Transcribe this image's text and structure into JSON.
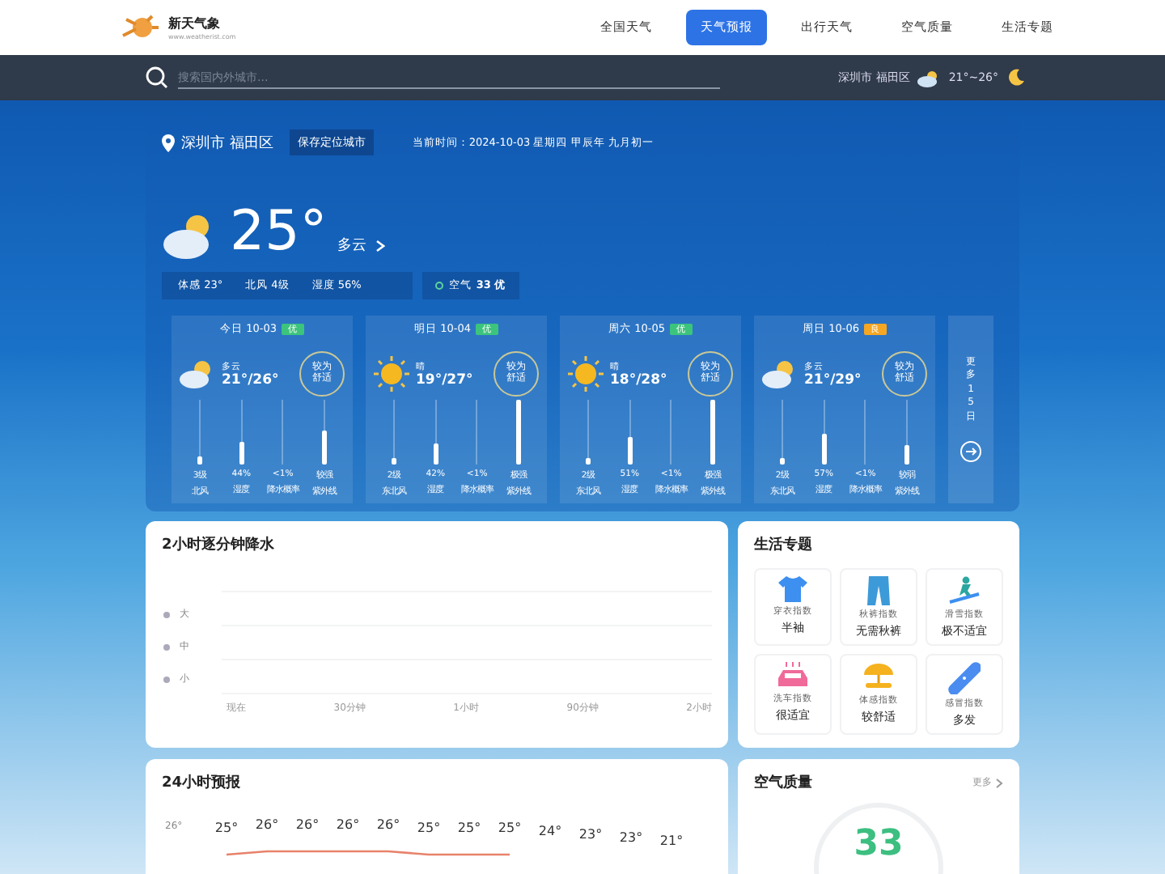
{
  "header": {
    "logo_title": "新天气象",
    "logo_url": "www.weatherist.com",
    "nav": [
      {
        "label": "全国天气",
        "selected": false
      },
      {
        "label": "天气预报",
        "selected": true
      },
      {
        "label": "出行天气",
        "selected": false
      },
      {
        "label": "空气质量",
        "selected": false
      },
      {
        "label": "生活专题",
        "selected": false
      }
    ]
  },
  "search_bar": {
    "placeholder": "搜索国内外城市...",
    "location": "深圳市 福田区",
    "temp_range": "21°~26°"
  },
  "current": {
    "location": "深圳市 福田区",
    "save_button": "保存定位城市",
    "time": "当前时间：2024-10-03 星期四 甲辰年 九月初一",
    "temperature": "25°",
    "condition": "多云",
    "details": [
      "体感 23°",
      "北风 4级",
      "湿度 56%"
    ],
    "air_label": "空气",
    "air_value": "33 优"
  },
  "days": [
    {
      "title": "今日 10-03",
      "aqi": "优",
      "color": "#3cc47c",
      "kind": "partly-cloudy",
      "condition": "多云",
      "temps": "21°/26°",
      "comfort": "较为舒适",
      "stats": [
        {
          "value": "3级",
          "label": "北风",
          "level": 0.12
        },
        {
          "value": "44%",
          "label": "湿度",
          "level": 0.35
        },
        {
          "value": "<1%",
          "label": "降水概率",
          "level": 0
        },
        {
          "value": "较强",
          "label": "紫外线",
          "level": 0.52
        }
      ]
    },
    {
      "title": "明日 10-04",
      "aqi": "优",
      "color": "#3cc47c",
      "kind": "sunny",
      "condition": "晴",
      "temps": "19°/27°",
      "comfort": "较为舒适",
      "stats": [
        {
          "value": "2级",
          "label": "东北风",
          "level": 0.08
        },
        {
          "value": "42%",
          "label": "湿度",
          "level": 0.33
        },
        {
          "value": "<1%",
          "label": "降水概率",
          "level": 0
        },
        {
          "value": "极强",
          "label": "紫外线",
          "level": 1
        }
      ]
    },
    {
      "title": "周六 10-05",
      "aqi": "优",
      "color": "#3cc47c",
      "kind": "sunny",
      "condition": "晴",
      "temps": "18°/28°",
      "comfort": "较为舒适",
      "stats": [
        {
          "value": "2级",
          "label": "东北风",
          "level": 0.08
        },
        {
          "value": "51%",
          "label": "湿度",
          "level": 0.42
        },
        {
          "value": "<1%",
          "label": "降水概率",
          "level": 0
        },
        {
          "value": "极强",
          "label": "紫外线",
          "level": 1
        }
      ]
    },
    {
      "title": "周日 10-06",
      "aqi": "良",
      "color": "#f5a623",
      "kind": "partly-cloudy",
      "condition": "多云",
      "temps": "21°/29°",
      "comfort": "较为舒适",
      "stats": [
        {
          "value": "2级",
          "label": "东北风",
          "level": 0.08
        },
        {
          "value": "57%",
          "label": "湿度",
          "level": 0.47
        },
        {
          "value": "<1%",
          "label": "降水概率",
          "level": 0
        },
        {
          "value": "较弱",
          "label": "紫外线",
          "level": 0.3
        }
      ]
    }
  ],
  "more_days": "更多15日",
  "precipitation": {
    "title": "2小时逐分钟降水",
    "levels": [
      "大",
      "中",
      "小"
    ],
    "time_labels": [
      "现在",
      "30分钟",
      "1小时",
      "90分钟",
      "2小时"
    ]
  },
  "life": {
    "title": "生活专题",
    "items": [
      {
        "kind": "shirt",
        "name": "穿衣指数",
        "value": "半袖"
      },
      {
        "kind": "pants",
        "name": "秋裤指数",
        "value": "无需秋裤"
      },
      {
        "kind": "ski",
        "name": "滑雪指数",
        "value": "极不适宜"
      },
      {
        "kind": "car",
        "name": "洗车指数",
        "value": "很适宜"
      },
      {
        "kind": "beach",
        "name": "体感指数",
        "value": "较舒适"
      },
      {
        "kind": "bandage",
        "name": "感冒指数",
        "value": "多发"
      }
    ]
  },
  "hourly": {
    "title": "24小时预报",
    "axis_label": "26°",
    "temps": [
      "25°",
      "26°",
      "26°",
      "26°",
      "26°",
      "25°",
      "25°",
      "25°",
      "24°",
      "23°",
      "23°",
      "21°"
    ]
  },
  "air": {
    "title": "空气质量",
    "more": "更多",
    "aqi": "33"
  }
}
